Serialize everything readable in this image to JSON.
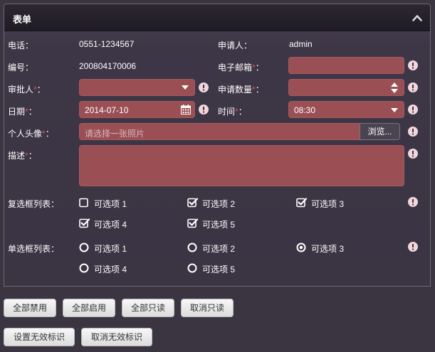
{
  "panel": {
    "title": "表单"
  },
  "fields": {
    "phone": {
      "label": "电话：",
      "value": "0551-1234567"
    },
    "applicant": {
      "label": "申请人：",
      "value": "admin"
    },
    "number": {
      "label": "编号：",
      "value": "200804170006"
    },
    "email": {
      "label": "电子邮箱",
      "required_mark": "*",
      "suffix": "：",
      "value": ""
    },
    "approver": {
      "label": "审批人",
      "required_mark": "*",
      "suffix": "：",
      "value": ""
    },
    "quantity": {
      "label": "申请数量",
      "required_mark": "*",
      "suffix": "：",
      "value": ""
    },
    "date": {
      "label": "日期",
      "required_mark": "*",
      "suffix": "：",
      "value": "2014-07-10"
    },
    "time": {
      "label": "时间",
      "required_mark": "*",
      "suffix": "：",
      "value": "08:30"
    },
    "avatar": {
      "label": "个人头像",
      "required_mark": "*",
      "suffix": "：",
      "placeholder": "请选择一张照片",
      "browse_label": "浏览..."
    },
    "description": {
      "label": "描述",
      "required_mark": "*",
      "suffix": "：",
      "value": ""
    }
  },
  "checkbox_group": {
    "label": "复选框列表：",
    "options": [
      {
        "label": "可选项 1",
        "checked": false
      },
      {
        "label": "可选项 2",
        "checked": true
      },
      {
        "label": "可选项 3",
        "checked": true
      },
      {
        "label": "可选项 4",
        "checked": true
      },
      {
        "label": "可选项 5",
        "checked": true
      }
    ]
  },
  "radio_group": {
    "label": "单选框列表：",
    "options": [
      {
        "label": "可选项 1",
        "selected": false
      },
      {
        "label": "可选项 2",
        "selected": false
      },
      {
        "label": "可选项 3",
        "selected": true
      },
      {
        "label": "可选项 4",
        "selected": false
      },
      {
        "label": "可选项 5",
        "selected": false
      }
    ]
  },
  "buttons": {
    "disable_all": "全部禁用",
    "enable_all": "全部启用",
    "readonly_all": "全部只读",
    "cancel_readonly": "取消只读",
    "set_invalid": "设置无效标识",
    "cancel_invalid": "取消无效标识"
  },
  "colors": {
    "background": "#3b3542",
    "field_invalid": "#9a4f55",
    "warning_icon": "#f2d6dc",
    "required_mark": "#d9534f"
  },
  "icons": {
    "collapse": "chevron-up-icon",
    "warning": "exclamation-circle-icon",
    "select": "caret-down-icon",
    "spinner": "up-down-arrows-icon",
    "calendar": "calendar-icon"
  }
}
